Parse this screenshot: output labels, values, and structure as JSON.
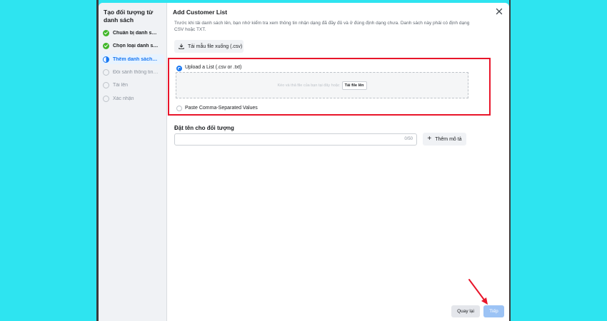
{
  "sidebar": {
    "title": "Tạo đối tượng từ danh sách",
    "steps": [
      {
        "label": "Chuẩn bị danh sách",
        "state": "done"
      },
      {
        "label": "Chọn loại danh sách",
        "state": "done"
      },
      {
        "label": "Thêm danh sách kh...",
        "state": "active"
      },
      {
        "label": "Đối sánh thông tin n...",
        "state": "pending"
      },
      {
        "label": "Tải lên",
        "state": "pending"
      },
      {
        "label": "Xác nhận",
        "state": "pending"
      }
    ]
  },
  "dialog": {
    "title": "Add Customer List",
    "close_icon": "close-icon",
    "description": "Trước khi tải danh sách lên, bạn nhớ kiểm tra xem thông tin nhận dạng đã đầy đủ và ở đúng định dạng chưa. Danh sách này phải có định dạng CSV hoặc TXT.",
    "download_template_label": "Tải mẫu file xuống (.csv)",
    "upload_option": {
      "label": "Upload a List (.csv or .txt)",
      "selected": true,
      "dropzone_text": "Kéo và thả file của bạn tại đây hoặc",
      "upload_button": "Tải file lên"
    },
    "paste_option": {
      "label": "Paste Comma-Separated Values",
      "selected": false
    },
    "name_section": {
      "label": "Đặt tên cho đối tượng",
      "value": "",
      "counter": "0/50",
      "add_description_label": "Thêm mô tả"
    }
  },
  "footer": {
    "back_label": "Quay lại",
    "next_label": "Tiếp"
  },
  "colors": {
    "accent": "#1877f2",
    "done": "#42b72a",
    "highlight": "#e8152a",
    "background": "#2ee4f0"
  }
}
